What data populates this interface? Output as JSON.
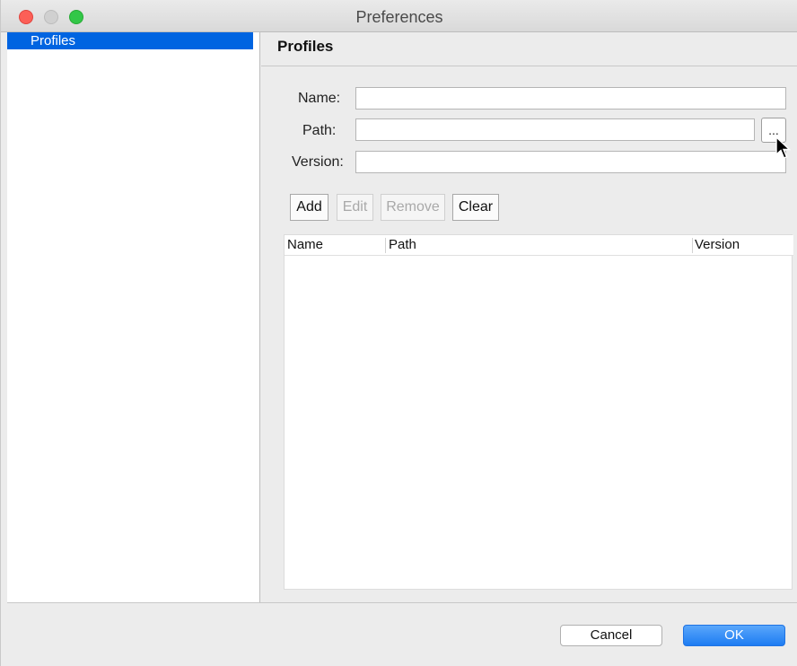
{
  "window": {
    "title": "Preferences"
  },
  "sidebar": {
    "items": [
      {
        "label": "Profiles",
        "selected": true
      }
    ]
  },
  "panel": {
    "title": "Profiles",
    "form": {
      "name_label": "Name:",
      "name_value": "",
      "path_label": "Path:",
      "path_value": "",
      "browse_label": "...",
      "version_label": "Version:",
      "version_value": ""
    },
    "actions": {
      "add": "Add",
      "edit": "Edit",
      "remove": "Remove",
      "clear": "Clear"
    },
    "table": {
      "columns": [
        "Name",
        "Path",
        "Version"
      ],
      "rows": []
    }
  },
  "footer": {
    "cancel": "Cancel",
    "ok": "OK"
  },
  "colors": {
    "selection": "#0064e1",
    "ok_button": "#1d7cf2",
    "close": "#fc5f57",
    "maximize": "#33c748"
  }
}
